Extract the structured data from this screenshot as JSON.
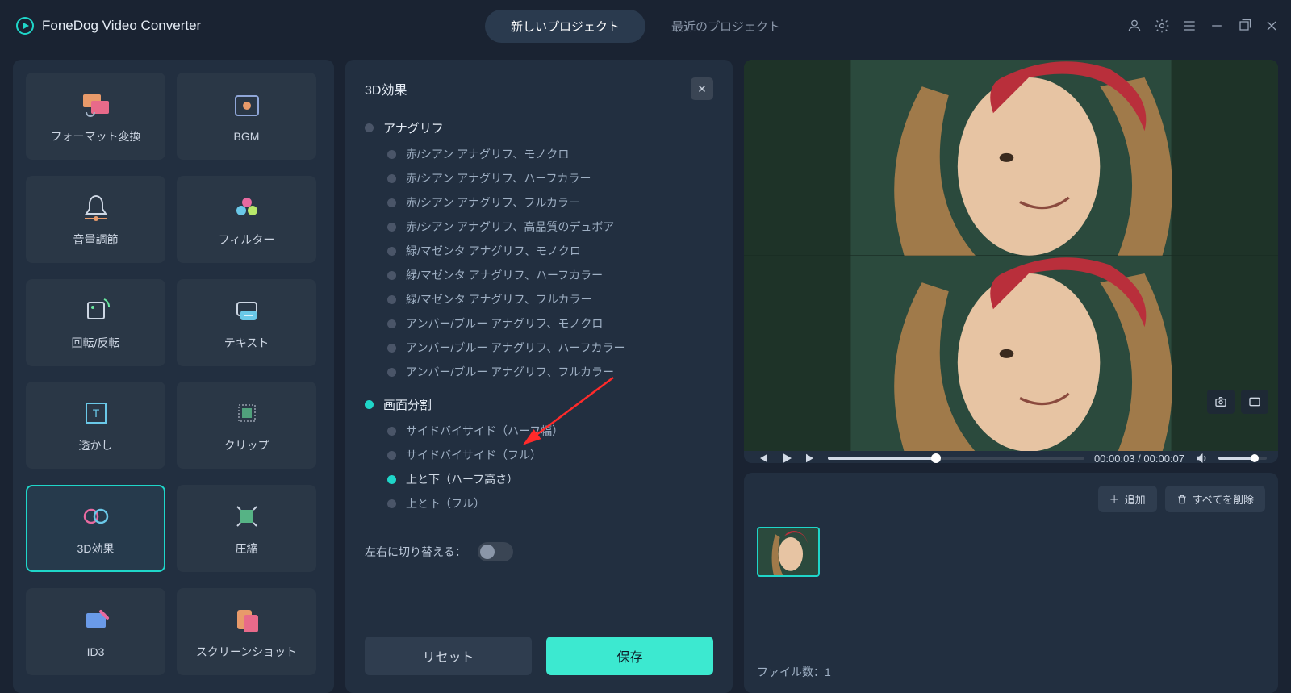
{
  "app_title": "FoneDog Video Converter",
  "tabs": {
    "new": "新しいプロジェクト",
    "recent": "最近のプロジェクト"
  },
  "tools": [
    {
      "id": "convert",
      "label": "フォーマット変換"
    },
    {
      "id": "bgm",
      "label": "BGM"
    },
    {
      "id": "volume",
      "label": "音量調節"
    },
    {
      "id": "filter",
      "label": "フィルター"
    },
    {
      "id": "rotate",
      "label": "回転/反転"
    },
    {
      "id": "text",
      "label": "テキスト"
    },
    {
      "id": "watermark",
      "label": "透かし"
    },
    {
      "id": "clip",
      "label": "クリップ"
    },
    {
      "id": "3d",
      "label": "3D効果",
      "active": true
    },
    {
      "id": "compress",
      "label": "圧縮"
    },
    {
      "id": "id3",
      "label": "ID3"
    },
    {
      "id": "screenshot",
      "label": "スクリーンショット"
    }
  ],
  "panel": {
    "title": "3D効果",
    "groups": [
      {
        "id": "anaglyph",
        "title": "アナグリフ",
        "selected": false,
        "options": [
          "赤/シアン アナグリフ、モノクロ",
          "赤/シアン アナグリフ、ハーフカラー",
          "赤/シアン アナグリフ、フルカラー",
          "赤/シアン アナグリフ、高品質のデュボア",
          "緑/マゼンタ アナグリフ、モノクロ",
          "緑/マゼンタ アナグリフ、ハーフカラー",
          "緑/マゼンタ アナグリフ、フルカラー",
          "アンバー/ブルー アナグリフ、モノクロ",
          "アンバー/ブルー アナグリフ、ハーフカラー",
          "アンバー/ブルー アナグリフ、フルカラー"
        ]
      },
      {
        "id": "split",
        "title": "画面分割",
        "selected": true,
        "selected_option": 2,
        "options": [
          "サイドバイサイド（ハーフ幅）",
          "サイドバイサイド（フル）",
          "上と下（ハーフ高さ）",
          "上と下（フル）"
        ]
      }
    ],
    "swap_label": "左右に切り替える：",
    "reset": "リセット",
    "save": "保存"
  },
  "player": {
    "current": "00:00:03",
    "duration": "00:00:07"
  },
  "queue": {
    "add": "追加",
    "remove_all": "すべてを削除",
    "file_count_label": "ファイル数：",
    "file_count": "1"
  }
}
